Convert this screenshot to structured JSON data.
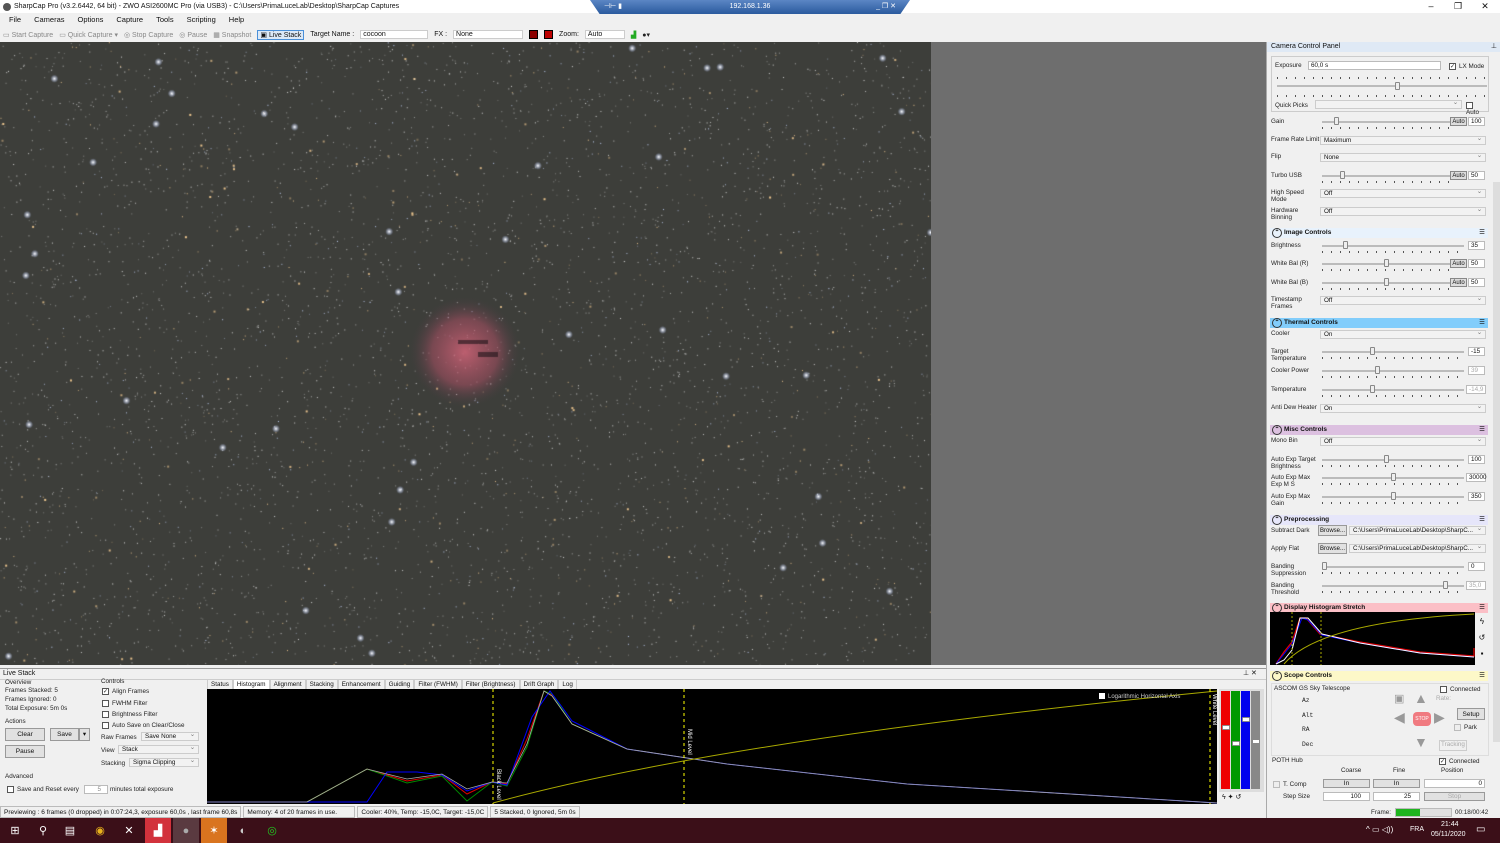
{
  "window": {
    "title": "SharpCap Pro (v3.2.6442, 64 bit) - ZWO ASI2600MC Pro (via USB3) - C:\\Users\\PrimaLuceLab\\Desktop\\SharpCap Captures",
    "remote_host": "192.168.1.36"
  },
  "menu": [
    "File",
    "Cameras",
    "Options",
    "Capture",
    "Tools",
    "Scripting",
    "Help"
  ],
  "toolbar": {
    "start_capture": "Start Capture",
    "quick_capture": "Quick Capture",
    "stop_capture": "Stop Capture",
    "pause": "Pause",
    "snapshot": "Snapshot",
    "live_stack": "Live Stack",
    "target_label": "Target Name :",
    "target_value": "cocoon",
    "fx_label": "FX :",
    "fx_value": "None",
    "zoom_label": "Zoom:",
    "zoom_value": "Auto"
  },
  "camera_panel": {
    "title": "Camera Control Panel",
    "exposure_label": "Exposure",
    "exposure_value": "60,0 s",
    "lx_mode": "LX Mode",
    "lx_checked": true,
    "quick_picks": "Quick Picks",
    "auto_label": "Auto",
    "rows": [
      {
        "label": "Gain",
        "type": "slider",
        "value": "100",
        "auto": "Auto",
        "pos": 0.1
      },
      {
        "label": "Frame Rate Limit",
        "type": "select",
        "value": "Maximum"
      },
      {
        "label": "Flip",
        "type": "select",
        "value": "None"
      },
      {
        "label": "Turbo USB",
        "type": "slider",
        "value": "50",
        "auto": "Auto",
        "pos": 0.15
      },
      {
        "label": "High Speed Mode",
        "type": "select",
        "value": "Off"
      },
      {
        "label": "Hardware Binning",
        "type": "select",
        "value": "Off"
      },
      {
        "label": "Image Controls",
        "type": "section",
        "color": "#e8f2fc"
      },
      {
        "label": "Brightness",
        "type": "slider",
        "value": "35",
        "pos": 0.15
      },
      {
        "label": "White Bal (R)",
        "type": "slider",
        "value": "50",
        "auto": "Auto",
        "pos": 0.5
      },
      {
        "label": "White Bal (B)",
        "type": "slider",
        "value": "50",
        "auto": "Auto",
        "pos": 0.5
      },
      {
        "label": "Timestamp Frames",
        "type": "select",
        "value": "Off"
      },
      {
        "label": "Thermal Controls",
        "type": "section",
        "color": "#82cdfb"
      },
      {
        "label": "Cooler",
        "type": "select",
        "value": "On"
      },
      {
        "label": "Target Temperature",
        "type": "slider",
        "value": "-15",
        "pos": 0.35
      },
      {
        "label": "Cooler Power",
        "type": "slider",
        "value": "39",
        "pos": 0.39,
        "disabled": true
      },
      {
        "label": "Temperature",
        "type": "slider",
        "value": "-14,9",
        "pos": 0.35,
        "disabled": true
      },
      {
        "label": "Anti Dew Heater",
        "type": "select",
        "value": "On"
      },
      {
        "label": "Misc Controls",
        "type": "section",
        "color": "#dcc0e0"
      },
      {
        "label": "Mono Bin",
        "type": "select",
        "value": "Off"
      },
      {
        "label": "Auto Exp Target Brightness",
        "type": "slider",
        "value": "100",
        "pos": 0.45
      },
      {
        "label": "Auto Exp Max Exp M S",
        "type": "slider",
        "value": "30000",
        "pos": 0.5
      },
      {
        "label": "Auto Exp Max Gain",
        "type": "slider",
        "value": "350",
        "pos": 0.5
      },
      {
        "label": "Preprocessing",
        "type": "section",
        "color": "#e6e6fa"
      },
      {
        "label": "Subtract Dark",
        "type": "file",
        "button": "Browse...",
        "value": "C:\\Users\\PrimaLuceLab\\Desktop\\SharpC..."
      },
      {
        "label": "Apply Flat",
        "type": "file",
        "button": "Browse...",
        "value": "C:\\Users\\PrimaLuceLab\\Desktop\\SharpC..."
      },
      {
        "label": "Banding Suppression",
        "type": "slider",
        "value": "0",
        "pos": 0.0
      },
      {
        "label": "Banding Threshold",
        "type": "slider",
        "value": "35,0",
        "pos": 0.88,
        "disabled": true
      },
      {
        "label": "Display Histogram Stretch",
        "type": "section",
        "color": "#fbbfc6"
      },
      {
        "label": "Scope Controls",
        "type": "section",
        "color": "#fdf8c8"
      }
    ],
    "scope": {
      "name": "ASCOM GS Sky Telescope",
      "connected_label": "Connected",
      "az": "Az",
      "alt": "Alt",
      "ra": "RA",
      "dec": "Dec",
      "rate": "Rate:",
      "setup": "Setup",
      "park": "Park",
      "tracking": "Tracking",
      "stop": "STOP"
    },
    "focuser": {
      "name": "POTH Hub",
      "connected_label": "Connected",
      "coarse": "Coarse",
      "fine": "Fine",
      "position": "Position",
      "tcomp": "T. Comp",
      "in": "In",
      "position_value": "0",
      "step_size": "Step Size",
      "coarse_step": "100",
      "fine_step": "25",
      "stop": "Stop"
    },
    "frame_label": "Frame:",
    "frame_progress": 0.43,
    "frame_time": "00:18/00:42"
  },
  "live_stack": {
    "title": "Live Stack",
    "overview": "Overview",
    "frames_stacked": "Frames Stacked:  5",
    "frames_ignored": "Frames Ignored:  0",
    "total_exposure": "Total Exposure:   5m 0s",
    "actions": "Actions",
    "clear": "Clear",
    "save": "Save",
    "pause": "Pause",
    "advanced": "Advanced",
    "save_reset": "Save and Reset every",
    "save_reset_minutes": "5",
    "save_reset_suffix": "minutes total exposure",
    "controls": "Controls",
    "align_frames": "Align Frames",
    "fwhm_filter": "FWHM Filter",
    "brightness_filter": "Brightness Filter",
    "auto_save": "Auto Save on Clear/Close",
    "raw_frames_label": "Raw Frames",
    "raw_frames_value": "Save None",
    "view_label": "View",
    "view_value": "Stack",
    "stacking_label": "Stacking",
    "stacking_value": "Sigma Clipping",
    "tabs": [
      "Status",
      "Histogram",
      "Alignment",
      "Stacking",
      "Enhancement",
      "Guiding",
      "Filter (FWHM)",
      "Filter (Brightness)",
      "Drift Graph",
      "Log"
    ],
    "active_tab": "Histogram",
    "log_axis": "Logarithmic Horizontal Axis",
    "black_level": "Black Level",
    "mid_level": "Mid Level",
    "white_level": "White Level"
  },
  "status": {
    "preview": "Previewing : 6 frames (0 dropped) in 0:07:24,3, exposure 60,0s , last frame 60,8s",
    "memory": "Memory: 4 of 20 frames in use.",
    "cooler": "Cooler: 40%, Temp: -15,0C, Target: -15,0C",
    "stack": "5 Stacked, 0 Ignored, 5m 0s"
  },
  "taskbar": {
    "lang": "FRA",
    "time": "21:44",
    "date": "05/11/2020"
  }
}
